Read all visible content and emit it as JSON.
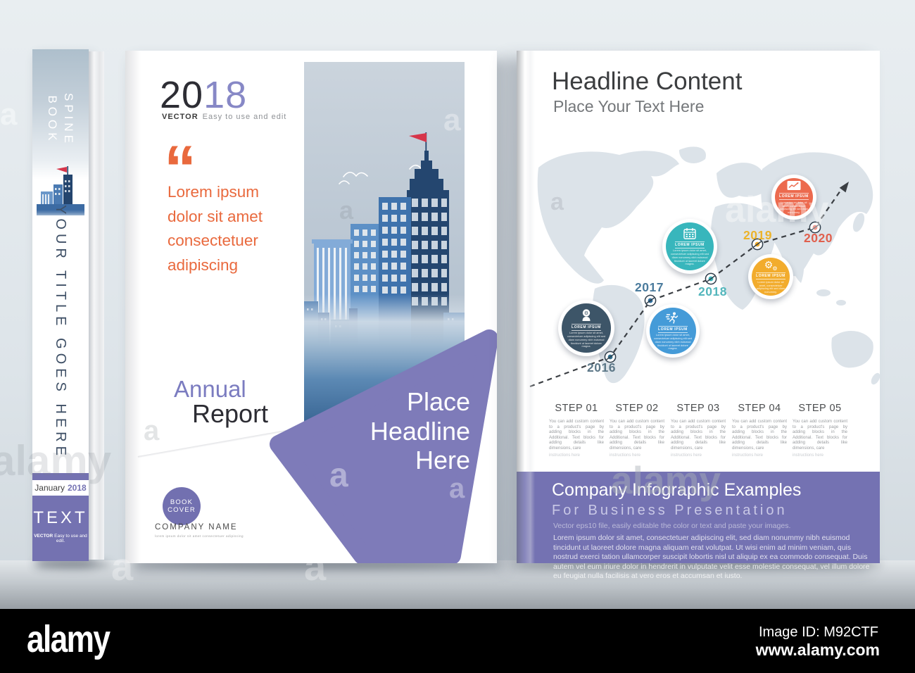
{
  "alamy_bar": {
    "logo": "alamy",
    "image_id": "Image ID: M92CTF",
    "url": "www.alamy.com"
  },
  "watermark_word": "alamy",
  "watermark_letter": "a",
  "icons": {
    "gear": "⚙"
  },
  "spine": {
    "top_line1": "SPINE",
    "top_line2": "BOOK",
    "title": "YOUR TITLE GOES HERE",
    "date_prefix": "January",
    "date_year": "2018",
    "text_label": "TEXT",
    "vector_bold": "VECTOR",
    "vector_rest": "Easy to use and edit."
  },
  "cover": {
    "year_black": "20",
    "year_purple": "18",
    "vector_bold": "VECTOR",
    "vector_rest": "Easy to use and edit",
    "quote_glyph": "“",
    "quote_lines": [
      "Lorem ipsum",
      "dolor sit amet",
      "consectetuer",
      "adipiscing"
    ],
    "title_accent": "Annual",
    "title_dark": "Report",
    "headline": [
      "Place",
      "Headline",
      "Here"
    ],
    "badge": [
      "BOOK",
      "COVER"
    ],
    "company_name": "COMPANY NAME",
    "company_tagline": "lorem ipsum dolor sit amet consectetuer adipiscing"
  },
  "page": {
    "headline": "Headline Content",
    "subheadline": "Place Your Text Here",
    "years": [
      {
        "label": "2016",
        "color": "#5d7888"
      },
      {
        "label": "2017",
        "color": "#4a7b9d"
      },
      {
        "label": "2018",
        "color": "#53b6bc"
      },
      {
        "label": "2019",
        "color": "#ecb32a"
      },
      {
        "label": "2020",
        "color": "#e0604e"
      }
    ],
    "milestones": [
      {
        "label": "LOREM IPSUM",
        "body": "Lorem ipsum dolor sit amet, consectetuer adipiscing elit sed diam nonummy nibh euismod tincidunt ut laoreet dolore magna.",
        "color": "#3d5568"
      },
      {
        "label": "LOREM IPSUM",
        "body": "Lorem ipsum dolor sit amet, consectetuer adipiscing elit sed diam nonummy nibh euismod tincidunt ut laoreet dolore magna.",
        "color": "#38b6bc"
      },
      {
        "label": "LOREM IPSUM",
        "body": "Lorem ipsum dolor sit amet, consectetuer adipiscing elit sed diam nonummy nibh euismod tincidunt ut laoreet dolore magna.",
        "color": "#459bd8"
      },
      {
        "label": "LOREM IPSUM",
        "body": "Lorem ipsum dolor sit amet, consectetuer adipiscing elit sed diam nonummy.",
        "color": "#f2ac2d"
      },
      {
        "label": "LOREM IPSUM",
        "body": "Lorem ipsum dolor sit amet, consectetuer adipiscing elit sed diam nonummy.",
        "color": "#ec6a4e"
      }
    ],
    "steps": [
      {
        "title": "STEP 01",
        "body": "You can add custom content to a product's page by adding blocks in the Additional. Text blocks for adding details like dimensions, care",
        "footnote": "instructions here"
      },
      {
        "title": "STEP 02",
        "body": "You can add custom content to a product's page by adding blocks in the Additional. Text blocks for adding details like dimensions, care",
        "footnote": "instructions here"
      },
      {
        "title": "STEP 03",
        "body": "You can add custom content to a product's page by adding blocks in the Additional. Text blocks for adding details like dimensions, care",
        "footnote": "instructions here"
      },
      {
        "title": "STEP 04",
        "body": "You can add custom content to a product's page by adding blocks in the Additional. Text blocks for adding details like dimensions, care",
        "footnote": "instructions here"
      },
      {
        "title": "STEP 05",
        "body": "You can add custom content to a product's page by adding blocks in the Additional. Text blocks for adding details like dimensions, care",
        "footnote": "instructions here"
      }
    ],
    "footer": {
      "title": "Company Infographic Examples",
      "subtitle": "For Business Presentation",
      "note": "Vector eps10 file, easily editable the color or text and paste your images.",
      "body": "Lorem ipsum dolor sit amet, consectetuer adipiscing elit, sed diam nonummy nibh euismod tincidunt ut laoreet dolore magna aliquam erat volutpat. Ut wisi enim ad minim veniam, quis nostrud exerci tation ullamcorper suscipit lobortis nisl ut aliquip ex ea commodo consequat. Duis autem vel eum iriure dolor in hendrerit in vulputate velit esse molestie consequat, vel illum dolore eu feugiat nulla facilisis at vero eros et accumsan et iusto."
    }
  },
  "colors": {
    "purple": "#7472b2",
    "accent_orange": "#e9693d",
    "navy": "#3d5568",
    "teal": "#38b6bc",
    "blue": "#459bd8",
    "yellow": "#f2ac2d",
    "red_orange": "#ec6a4e",
    "map": "#dce3e9",
    "background": "#dde4e9"
  }
}
